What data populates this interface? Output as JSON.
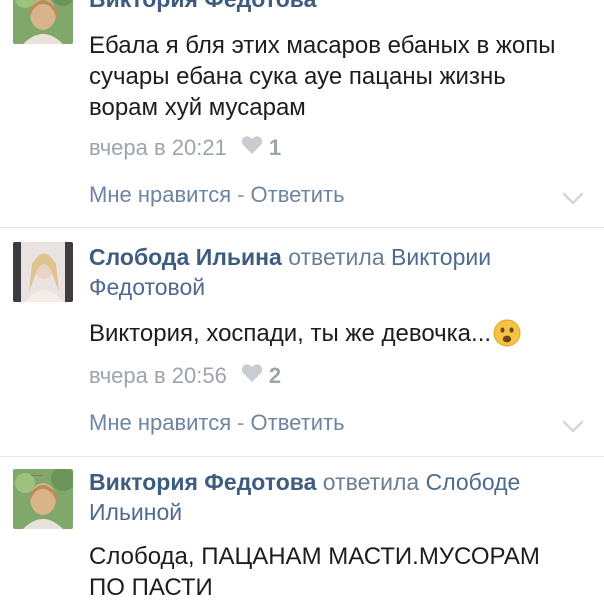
{
  "comments": [
    {
      "author": "Виктория Федотова",
      "text": "Ебала я бля этих масаров ебаных в жопы сучары ебана сука ауе пацаны жизнь ворам хуй мусарам",
      "time": "вчера в 20:21",
      "likes": "1",
      "like_label": "Мне нравится",
      "separator": "-",
      "reply_label": "Ответить"
    },
    {
      "author": "Слобода Ильина",
      "reply_verb": "ответила",
      "reply_to": "Виктории Федотовой",
      "text": "Виктория, хоспади, ты же девочка...",
      "emoji": "frowning-face-emoji",
      "time": "вчера в 20:56",
      "likes": "2",
      "like_label": "Мне нравится",
      "separator": "-",
      "reply_label": "Ответить"
    },
    {
      "author": "Виктория Федотова",
      "reply_verb": "ответила",
      "reply_to": "Слободе Ильиной",
      "text": "Слобода, ПАЦАНАМ МАСТИ.МУСОРАМ ПО ПАСТИ"
    }
  ],
  "icons": {
    "heart": "heart-icon",
    "chevron": "chevron-down-icon"
  },
  "colors": {
    "author": "#3e5b80",
    "link": "#6d85a2",
    "meta": "#9ea4ab",
    "text": "#1d1d1d",
    "divider": "#e3e6ea"
  }
}
